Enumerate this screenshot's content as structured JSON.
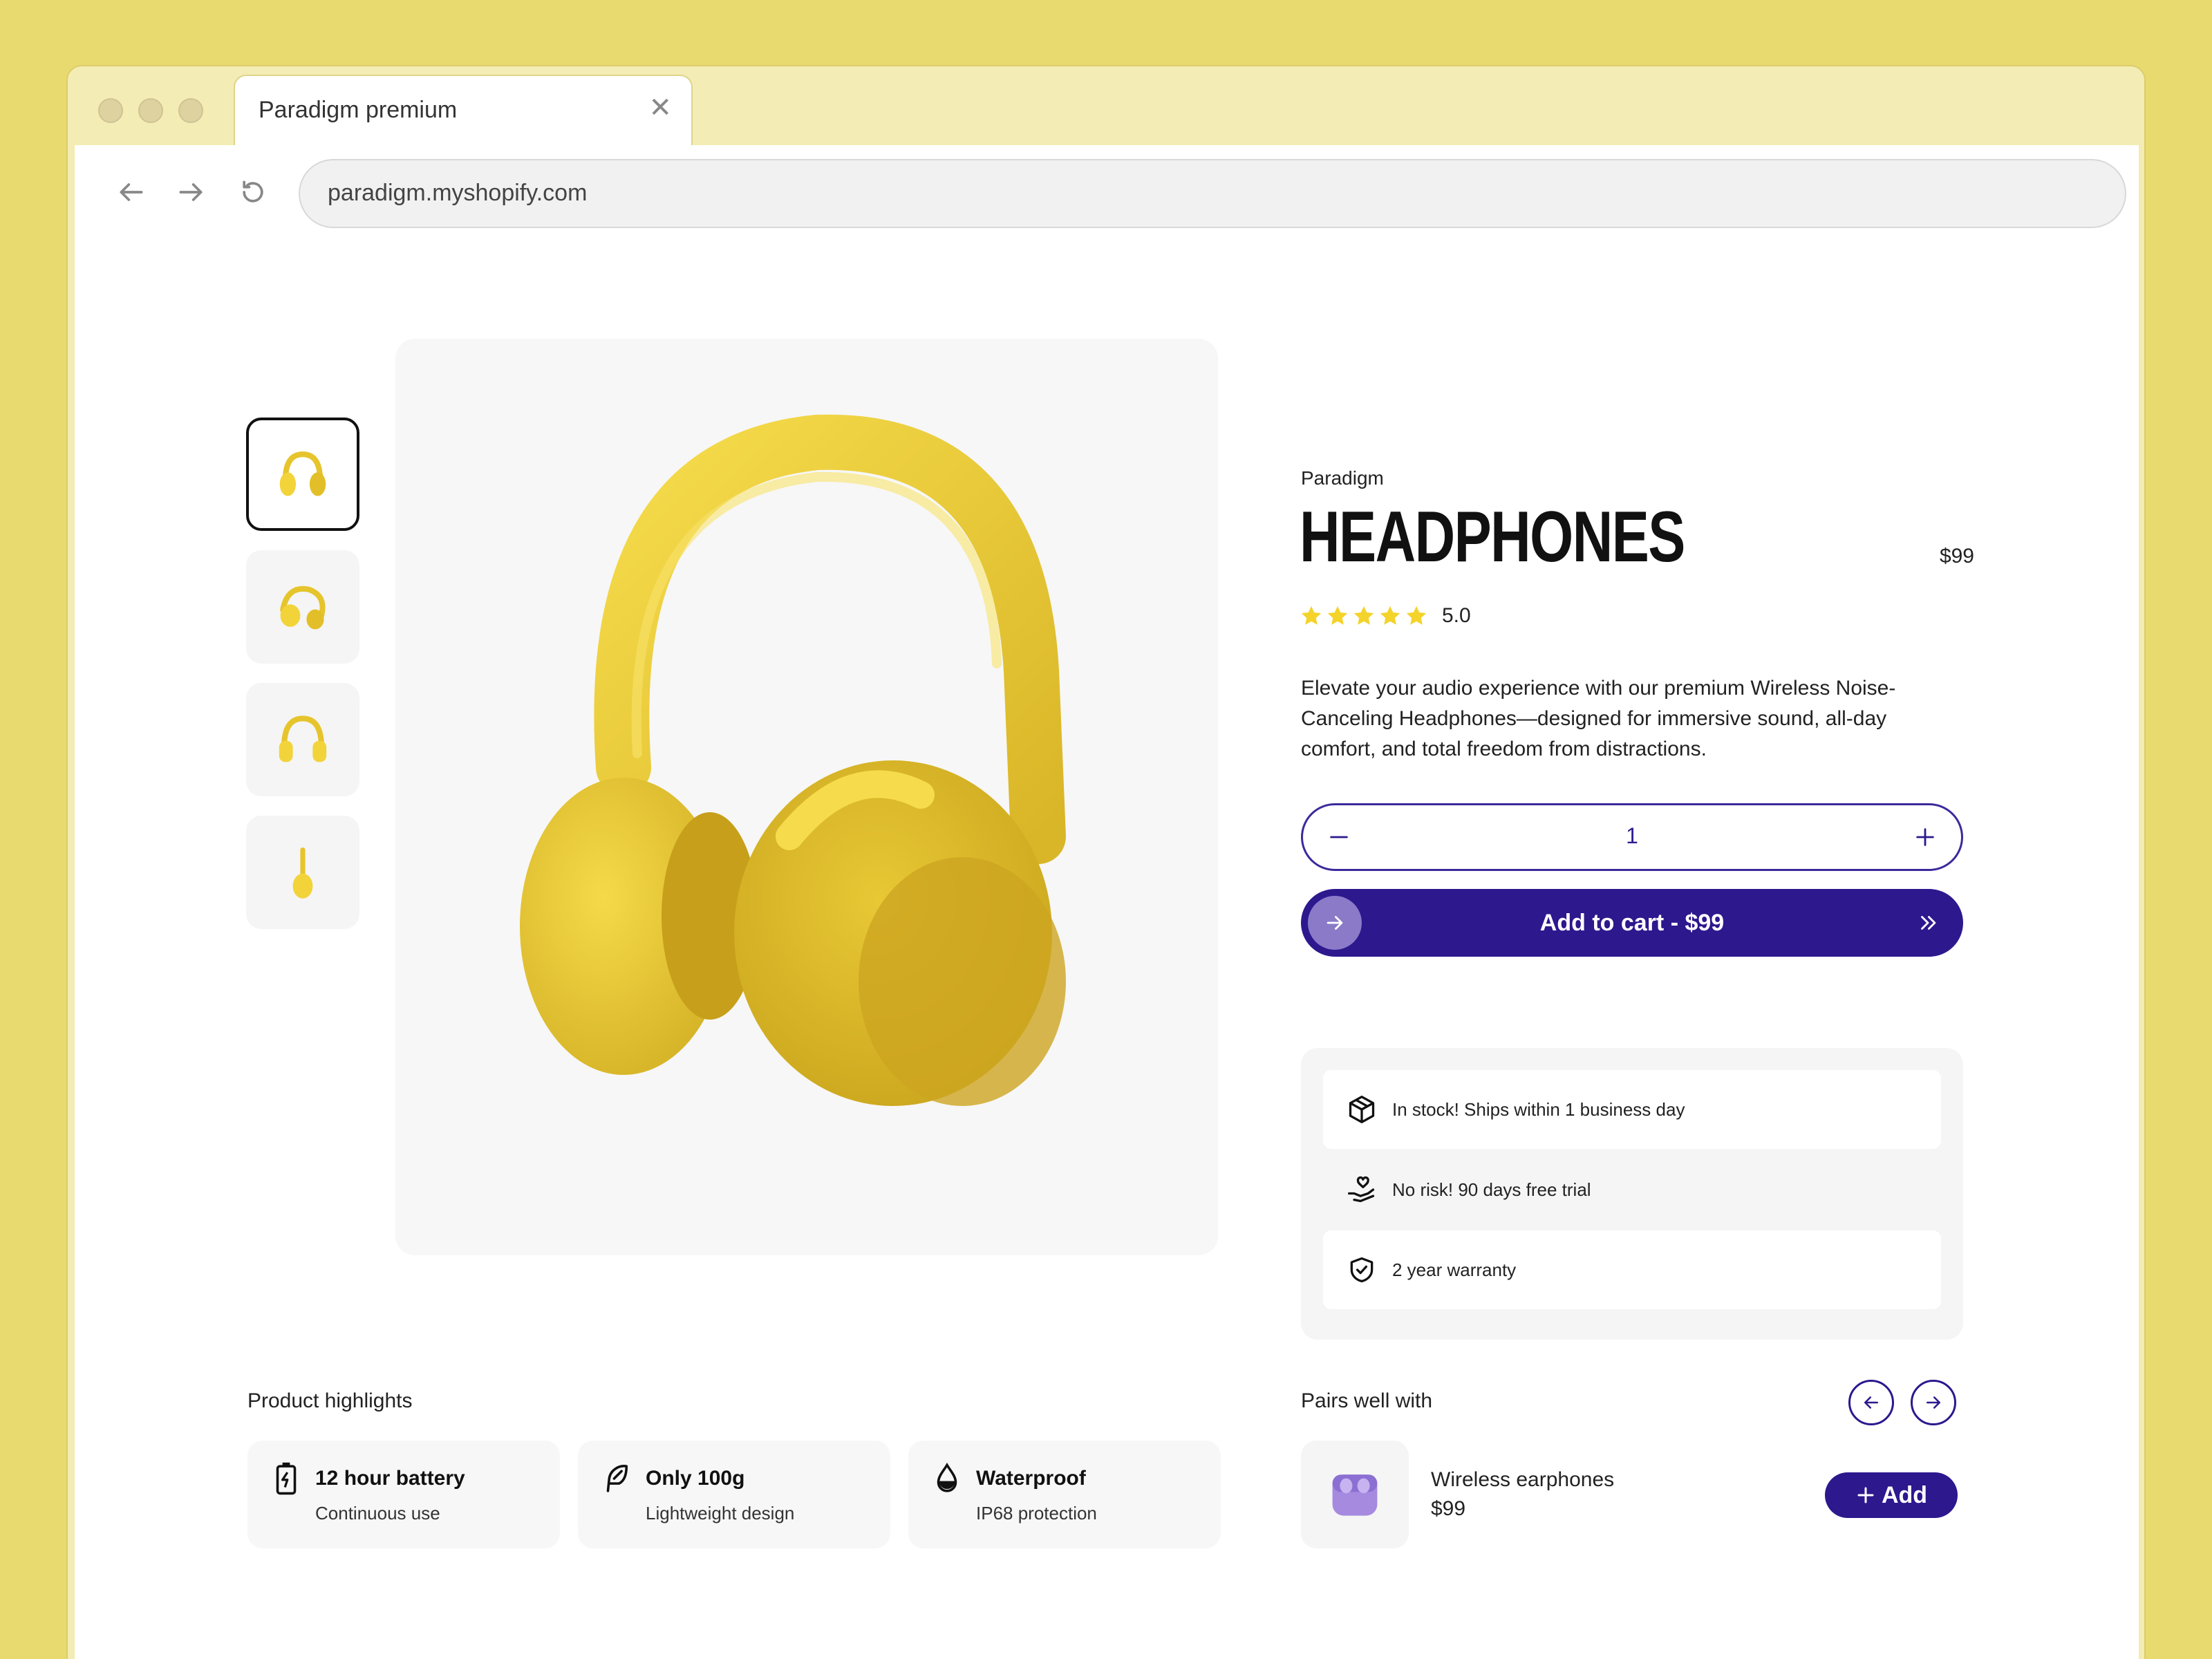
{
  "browser": {
    "tab_title": "Paradigm premium",
    "url": "paradigm.myshopify.com"
  },
  "product": {
    "brand": "Paradigm",
    "title": "HEADPHONES",
    "price": "$99",
    "rating": "5.0",
    "stars": 5,
    "description": "Elevate your audio experience with our premium Wireless Noise-Canceling  Headphones—designed for immersive sound, all-day comfort, and total  freedom from distractions.",
    "quantity": "1",
    "add_to_cart_label": "Add to cart - $99",
    "thumbnails": [
      "headphones-angle-view",
      "headphones-side-view",
      "headphones-front-view",
      "headphones-profile-view"
    ]
  },
  "perks": [
    {
      "icon": "box-icon",
      "text": "In stock! Ships within 1 business day"
    },
    {
      "icon": "hand-heart-icon",
      "text": "No risk! 90 days free trial"
    },
    {
      "icon": "shield-check-icon",
      "text": "2 year warranty"
    }
  ],
  "highlights": {
    "heading": "Product highlights",
    "items": [
      {
        "icon": "battery-icon",
        "title": "12 hour battery",
        "subtitle": "Continuous use"
      },
      {
        "icon": "feather-icon",
        "title": "Only 100g",
        "subtitle": "Lightweight design"
      },
      {
        "icon": "water-drop-icon",
        "title": "Waterproof",
        "subtitle": "IP68 protection"
      }
    ]
  },
  "pairs": {
    "heading": "Pairs well with",
    "item": {
      "name": "Wireless earphones",
      "price": "$99",
      "add_label": "Add"
    }
  },
  "colors": {
    "background": "#e8da6e",
    "accent": "#2d188e",
    "star": "#f4d32a",
    "product": "#f2d33a"
  }
}
